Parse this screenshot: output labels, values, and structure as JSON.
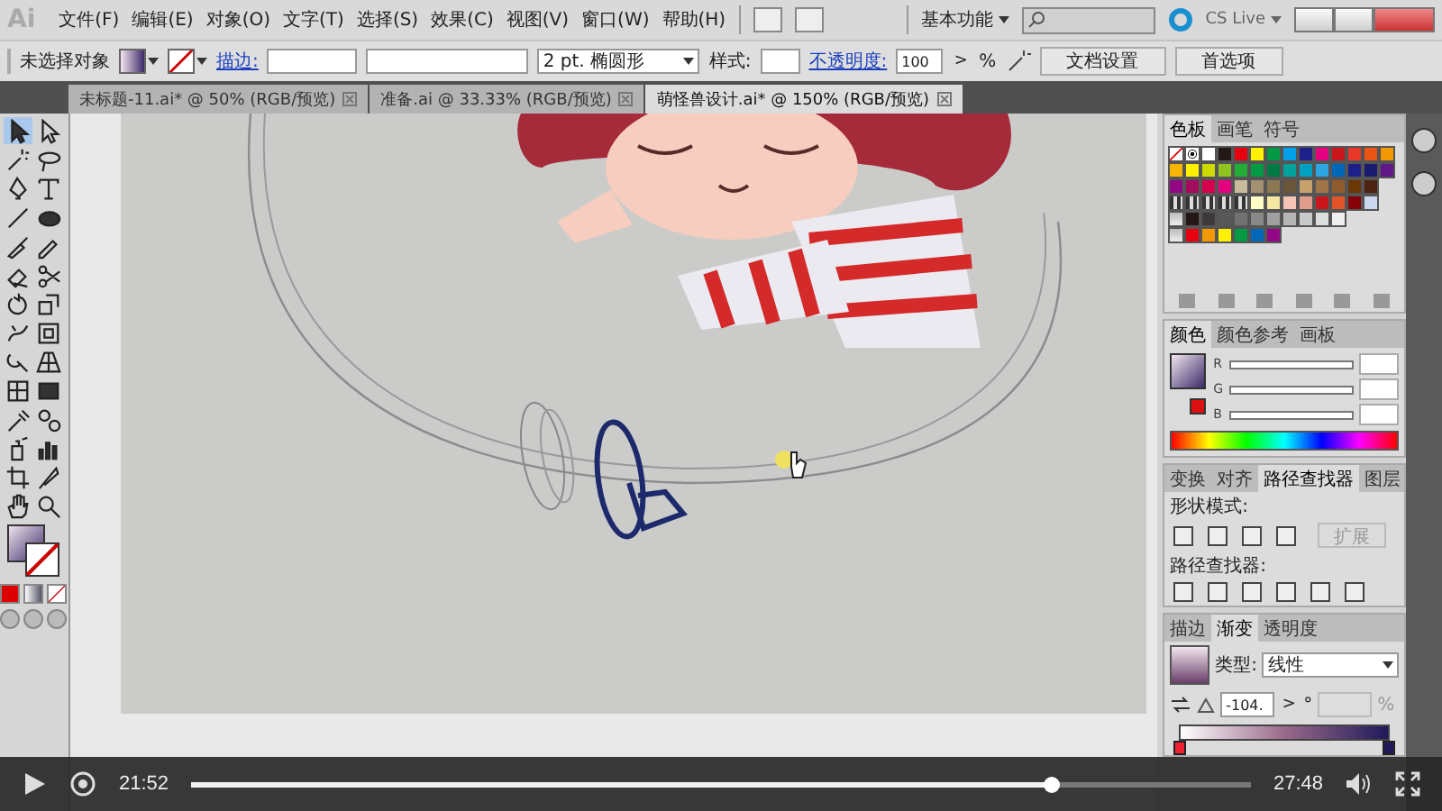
{
  "menu_bar": {
    "logo": "Ai",
    "items": [
      "文件(F)",
      "编辑(E)",
      "对象(O)",
      "文字(T)",
      "选择(S)",
      "效果(C)",
      "视图(V)",
      "窗口(W)",
      "帮助(H)"
    ],
    "workspace": "基本功能",
    "cs_live": "CS Live"
  },
  "control_bar": {
    "selection": "未选择对象",
    "stroke_label": "描边:",
    "brush": "2 pt. 椭圆形",
    "style_label": "样式:",
    "opacity_label": "不透明度:",
    "opacity_value": "100",
    "opacity_arrow": ">",
    "percent": "%",
    "buttons": [
      "文档设置",
      "首选项"
    ]
  },
  "document_tabs": [
    {
      "label": "未标题-11.ai* @ 50% (RGB/预览)",
      "selected": false
    },
    {
      "label": "准备.ai @ 33.33% (RGB/预览)",
      "selected": false
    },
    {
      "label": "萌怪兽设计.ai* @ 150% (RGB/预览)",
      "selected": true
    }
  ],
  "tools": [
    {
      "kind": "selection",
      "selected": true
    },
    {
      "kind": "direct",
      "selected": false
    },
    {
      "kind": "wand",
      "selected": false
    },
    {
      "kind": "lasso",
      "selected": false
    },
    {
      "kind": "pen",
      "selected": false
    },
    {
      "kind": "type",
      "selected": false
    },
    {
      "kind": "line",
      "selected": false
    },
    {
      "kind": "ellipse",
      "selected": false
    },
    {
      "kind": "brush",
      "selected": false
    },
    {
      "kind": "pencil",
      "selected": false
    },
    {
      "kind": "eraser",
      "selected": false
    },
    {
      "kind": "scissors",
      "selected": false
    },
    {
      "kind": "rotate",
      "selected": false
    },
    {
      "kind": "scale",
      "selected": false
    },
    {
      "kind": "warp",
      "selected": false
    },
    {
      "kind": "transform",
      "selected": false
    },
    {
      "kind": "builder",
      "selected": false
    },
    {
      "kind": "perspective",
      "selected": false
    },
    {
      "kind": "mesh",
      "selected": false
    },
    {
      "kind": "gradient",
      "selected": false
    },
    {
      "kind": "eyedropper",
      "selected": false
    },
    {
      "kind": "blend",
      "selected": false
    },
    {
      "kind": "sprayer",
      "selected": false
    },
    {
      "kind": "graph",
      "selected": false
    },
    {
      "kind": "artboard",
      "selected": false
    },
    {
      "kind": "slice",
      "selected": false
    },
    {
      "kind": "hand",
      "selected": false
    },
    {
      "kind": "zoom",
      "selected": false
    }
  ],
  "swatches_panel": {
    "tabs": [
      {
        "label": "色板",
        "selected": true
      },
      {
        "label": "画笔",
        "selected": false
      },
      {
        "label": "符号",
        "selected": false
      }
    ],
    "rows": [
      [
        {
          "kind": "none"
        },
        {
          "kind": "registration"
        },
        {
          "kind": "color",
          "color": "#ffffff"
        },
        {
          "kind": "color",
          "color": "#231815"
        },
        {
          "kind": "color",
          "color": "#e60012"
        },
        {
          "kind": "color",
          "color": "#fff100"
        },
        {
          "kind": "color",
          "color": "#009944"
        },
        {
          "kind": "color",
          "color": "#00a0e9"
        },
        {
          "kind": "color",
          "color": "#1d2088"
        },
        {
          "kind": "color",
          "color": "#e4007f"
        },
        {
          "kind": "color",
          "color": "#c9161d"
        },
        {
          "kind": "color",
          "color": "#e83828"
        },
        {
          "kind": "color",
          "color": "#ea5514"
        },
        {
          "kind": "color",
          "color": "#f39800"
        }
      ],
      [
        {
          "kind": "color",
          "color": "#f8b500"
        },
        {
          "kind": "color",
          "color": "#fff100"
        },
        {
          "kind": "color",
          "color": "#cfdb00"
        },
        {
          "kind": "color",
          "color": "#8fc31f"
        },
        {
          "kind": "color",
          "color": "#22ac38"
        },
        {
          "kind": "color",
          "color": "#009944"
        },
        {
          "kind": "color",
          "color": "#007b43"
        },
        {
          "kind": "color",
          "color": "#00a29a"
        },
        {
          "kind": "color",
          "color": "#00a0c1"
        },
        {
          "kind": "color",
          "color": "#2ca6e0"
        },
        {
          "kind": "color",
          "color": "#0068b7"
        },
        {
          "kind": "color",
          "color": "#1d2088"
        },
        {
          "kind": "color",
          "color": "#1a1a6e"
        },
        {
          "kind": "color",
          "color": "#601986"
        }
      ],
      [
        {
          "kind": "color",
          "color": "#920783"
        },
        {
          "kind": "color",
          "color": "#a40b5d"
        },
        {
          "kind": "color",
          "color": "#d7004c"
        },
        {
          "kind": "color",
          "color": "#e4007f"
        },
        {
          "kind": "color",
          "color": "#c9bc9c"
        },
        {
          "kind": "color",
          "color": "#a39171"
        },
        {
          "kind": "color",
          "color": "#8c7853"
        },
        {
          "kind": "color",
          "color": "#6a5638"
        },
        {
          "kind": "color",
          "color": "#c7a16c"
        },
        {
          "kind": "color",
          "color": "#a0754a"
        },
        {
          "kind": "color",
          "color": "#8e5b2d"
        },
        {
          "kind": "color",
          "color": "#6a3906"
        },
        {
          "kind": "color",
          "color": "#4c2212"
        }
      ],
      [
        {
          "kind": "pattern"
        },
        {
          "kind": "pattern"
        },
        {
          "kind": "pattern"
        },
        {
          "kind": "pattern"
        },
        {
          "kind": "pattern"
        },
        {
          "kind": "color",
          "color": "#fffbc7"
        },
        {
          "kind": "color",
          "color": "#f5e8a3"
        },
        {
          "kind": "color",
          "color": "#f4c4b7"
        },
        {
          "kind": "color",
          "color": "#e29c8d"
        },
        {
          "kind": "color",
          "color": "#c9161d"
        },
        {
          "kind": "color",
          "color": "#e1542a"
        },
        {
          "kind": "color",
          "color": "#860007"
        },
        {
          "kind": "color",
          "color": "#ccd6ec"
        }
      ],
      [
        {
          "kind": "folder"
        },
        {
          "kind": "color",
          "color": "#231815"
        },
        {
          "kind": "color",
          "color": "#3e3a39"
        },
        {
          "kind": "color",
          "color": "#595757"
        },
        {
          "kind": "color",
          "color": "#727171"
        },
        {
          "kind": "color",
          "color": "#898989"
        },
        {
          "kind": "color",
          "color": "#9fa0a0"
        },
        {
          "kind": "color",
          "color": "#b5b5b6"
        },
        {
          "kind": "color",
          "color": "#c9caca"
        },
        {
          "kind": "color",
          "color": "#dcdddd"
        },
        {
          "kind": "color",
          "color": "#efefef"
        }
      ],
      [
        {
          "kind": "folder"
        },
        {
          "kind": "color",
          "color": "#e60012"
        },
        {
          "kind": "color",
          "color": "#f39800"
        },
        {
          "kind": "color",
          "color": "#fff100"
        },
        {
          "kind": "color",
          "color": "#009944"
        },
        {
          "kind": "color",
          "color": "#0068b7"
        },
        {
          "kind": "color",
          "color": "#920783"
        }
      ]
    ]
  },
  "color_panel": {
    "tabs": [
      {
        "label": "颜色",
        "selected": true
      },
      {
        "label": "颜色参考",
        "selected": false
      },
      {
        "label": "画板",
        "selected": false
      }
    ],
    "channels": [
      "R",
      "G",
      "B"
    ]
  },
  "pathfinder_panel": {
    "tabs": [
      {
        "label": "变换",
        "selected": false
      },
      {
        "label": "对齐",
        "selected": false
      },
      {
        "label": "路径查找器",
        "selected": true
      },
      {
        "label": "图层",
        "selected": false
      }
    ],
    "shape_modes_label": "形状模式:",
    "expand_button": "扩展",
    "pathfinders_label": "路径查找器:"
  },
  "gradient_panel": {
    "tabs": [
      {
        "label": "描边",
        "selected": false
      },
      {
        "label": "渐变",
        "selected": true
      },
      {
        "label": "透明度",
        "selected": false
      }
    ],
    "type_label": "类型:",
    "type_value": "线性",
    "angle_value": "-104.",
    "angle_arrow": ">",
    "degree": "°",
    "location_percent": "%"
  },
  "player": {
    "elapsed": "21:52",
    "duration": "27:48",
    "level": 0.81
  }
}
